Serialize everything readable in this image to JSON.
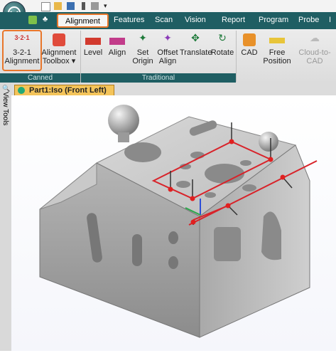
{
  "tabs": [
    "Alignment",
    "Features",
    "Scan",
    "Vision",
    "Report",
    "Program",
    "Probe",
    "I"
  ],
  "ribbon": {
    "canned": {
      "label": "Canned",
      "buttons": [
        {
          "label": "3-2-1\nAlignment",
          "icon": "321-alignment-icon"
        },
        {
          "label": "Alignment\nToolbox ▾",
          "icon": "alignment-toolbox-icon"
        }
      ]
    },
    "traditional": {
      "label": "Traditional",
      "buttons": [
        {
          "label": "Level",
          "icon": "level-icon"
        },
        {
          "label": "Align",
          "icon": "align-icon"
        },
        {
          "label": "Set\nOrigin",
          "icon": "set-origin-icon"
        },
        {
          "label": "Offset\nAlign",
          "icon": "offset-align-icon"
        },
        {
          "label": "Translate",
          "icon": "translate-icon"
        },
        {
          "label": "Rotate",
          "icon": "rotate-icon"
        }
      ]
    },
    "other": {
      "buttons": [
        {
          "label": "CAD",
          "icon": "cad-icon"
        },
        {
          "label": "Free\nPosition",
          "icon": "free-position-icon"
        },
        {
          "label": "Cloud-to-CAD",
          "icon": "cloud-to-cad-icon",
          "disabled": true
        }
      ]
    }
  },
  "sidebar": {
    "label": "View Tools"
  },
  "view": {
    "tab_label": "Part1:Iso (Front Left)"
  },
  "colors": {
    "brand": "#1f5e63",
    "highlight": "#e8762b",
    "tab_view": "#f4c45a"
  }
}
